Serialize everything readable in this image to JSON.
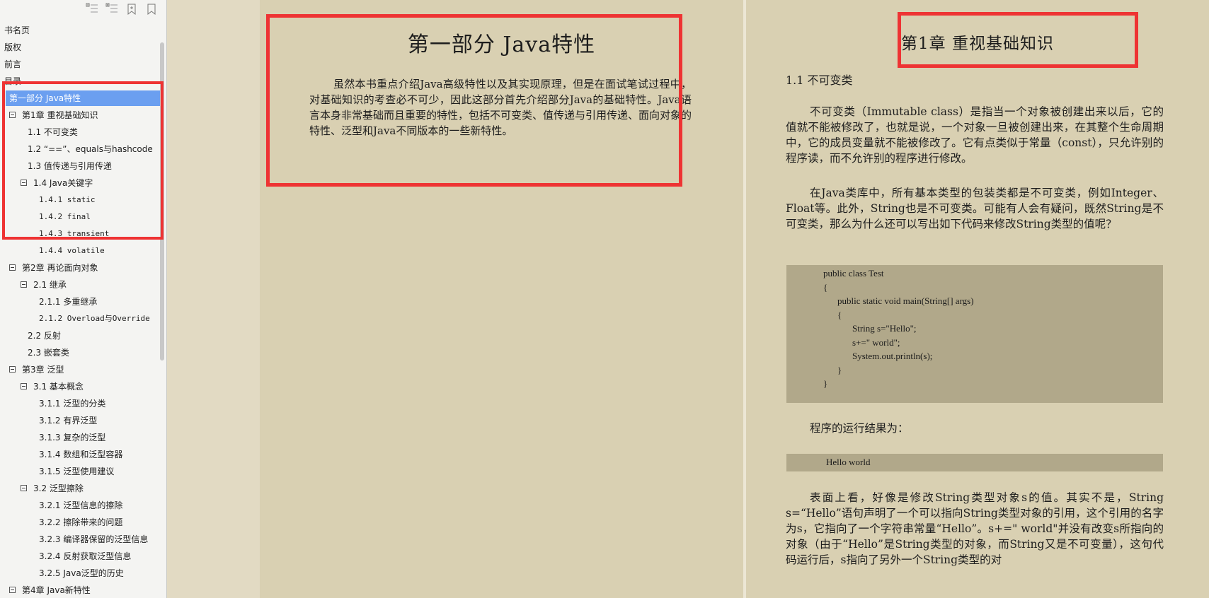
{
  "sidebar": {
    "toolbar_icons": [
      "collapse-all-icon",
      "expand-all-icon",
      "add-bookmark-icon",
      "bookmark-icon"
    ],
    "items": [
      {
        "label": "书名页"
      },
      {
        "label": "版权"
      },
      {
        "label": "前言"
      },
      {
        "label": "目录"
      },
      {
        "label": "第一部分 Java特性",
        "selected": true
      },
      {
        "label": "第1章 重视基础知识"
      },
      {
        "label": "1.1 不可变类"
      },
      {
        "label": "1.2 “==”、equals与hashcode"
      },
      {
        "label": "1.3 值传递与引用传递"
      },
      {
        "label": "1.4 Java关键字"
      },
      {
        "label": "1.4.1 static"
      },
      {
        "label": "1.4.2 final"
      },
      {
        "label": "1.4.3 transient"
      },
      {
        "label": "1.4.4 volatile"
      },
      {
        "label": "第2章 再论面向对象"
      },
      {
        "label": "2.1 继承"
      },
      {
        "label": "2.1.1 多重继承"
      },
      {
        "label": "2.1.2 Overload与Override"
      },
      {
        "label": "2.2 反射"
      },
      {
        "label": "2.3 嵌套类"
      },
      {
        "label": "第3章 泛型"
      },
      {
        "label": "3.1 基本概念"
      },
      {
        "label": "3.1.1 泛型的分类"
      },
      {
        "label": "3.1.2 有界泛型"
      },
      {
        "label": "3.1.3 复杂的泛型"
      },
      {
        "label": "3.1.4 数组和泛型容器"
      },
      {
        "label": "3.1.5 泛型使用建议"
      },
      {
        "label": "3.2 泛型擦除"
      },
      {
        "label": "3.2.1 泛型信息的擦除"
      },
      {
        "label": "3.2.2 擦除带来的问题"
      },
      {
        "label": "3.2.3 编译器保留的泛型信息"
      },
      {
        "label": "3.2.4 反射获取泛型信息"
      },
      {
        "label": "3.2.5 Java泛型的历史"
      },
      {
        "label": "第4章 Java新特性"
      }
    ]
  },
  "left_page": {
    "title": "第一部分 Java特性",
    "body": "虽然本书重点介绍Java高级特性以及其实现原理，但是在面试笔试过程中，对基础知识的考查必不可少，因此这部分首先介绍部分Java的基础特性。Java语言本身非常基础而且重要的特性，包括不可变类、值传递与引用传递、面向对象的特性、泛型和Java不同版本的一些新特性。"
  },
  "right_page": {
    "chapter_title": "第1章 重视基础知识",
    "section_heading": "1.1 不可变类",
    "para1": "不可变类（Immutable class）是指当一个对象被创建出来以后，它的值就不能被修改了，也就是说，一个对象一旦被创建出来，在其整个生命周期中，它的成员变量就不能被修改了。它有点类似于常量（const），只允许别的程序读，而不允许别的程序进行修改。",
    "para2": "在Java类库中，所有基本类型的包装类都是不可变类，例如Integer、Float等。此外，String也是不可变类。可能有人会有疑问，既然String是不可变类，那么为什么还可以写出如下代码来修改String类型的值呢？",
    "code_lines": [
      "public class Test",
      "{",
      "public static void main(String[] args)",
      "{",
      "String s=\"Hello\";",
      "s+=\" world\";",
      "System.out.println(s);",
      "}",
      "}"
    ],
    "run_label": "程序的运行结果为：",
    "output": "Hello world",
    "para3": "表面上看，好像是修改String类型对象s的值。其实不是，String s=“Hello”语句声明了一个可以指向String类型对象的引用，这个引用的名字为s，它指向了一个字符串常量“Hello”。s+=\" world\"并没有改变s所指向的对象（由于“Hello”是String类型的对象，而String又是不可变量），这句代码运行后，s指向了另外一个String类型的对"
  },
  "colors": {
    "highlight": "#ee3333",
    "selection": "#6b9ff0",
    "page_bg": "#d9d0b2",
    "code_bg": "#b1a88a"
  }
}
